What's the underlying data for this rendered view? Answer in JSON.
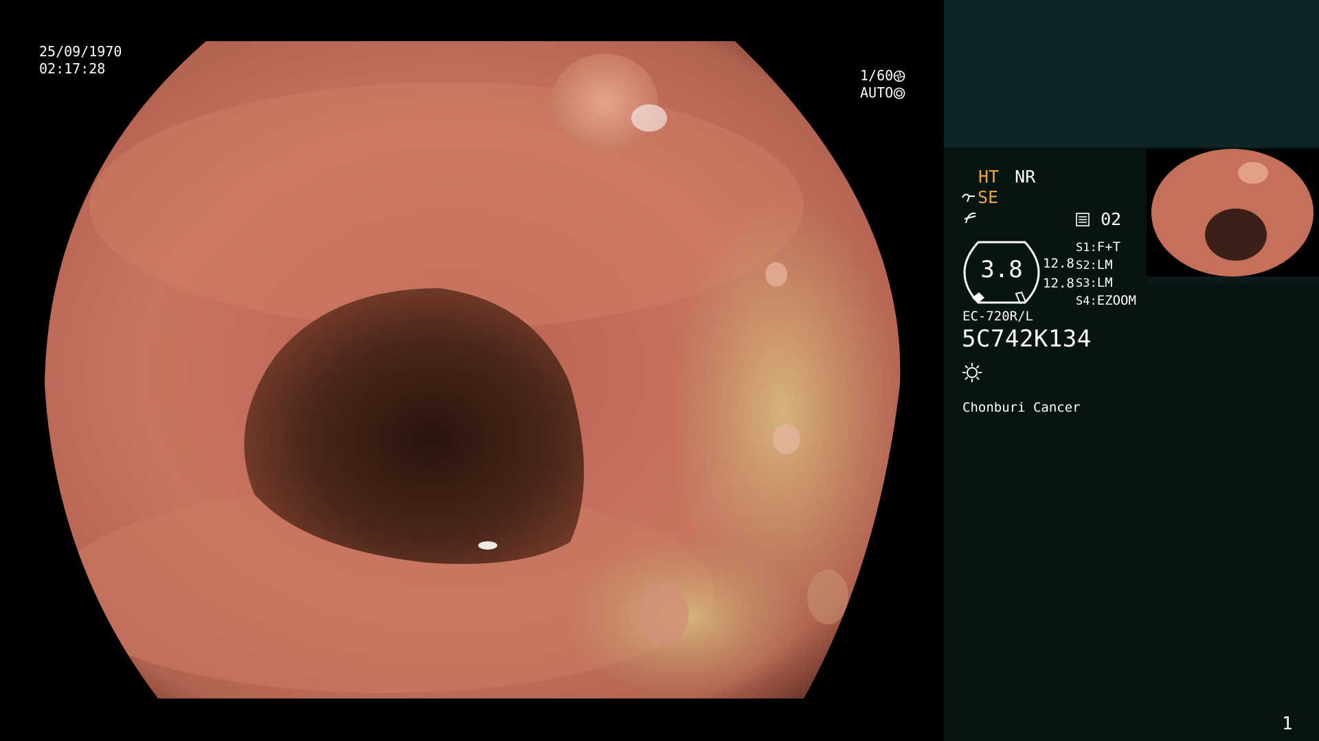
{
  "osd": {
    "date": "25/09/1970",
    "time": "02:17:28",
    "shutter": "1/60",
    "iris": "AUTO"
  },
  "panel": {
    "ht_label": "HT",
    "nr_label": "NR",
    "se_label": "SE",
    "mode_num": "02",
    "zoom_value": "3.8",
    "val_a": "12.8",
    "val_b": "12.8",
    "switches": [
      {
        "key": "S1:",
        "value": "F+T"
      },
      {
        "key": "S2:",
        "value": "LM"
      },
      {
        "key": "S3:",
        "value": "LM"
      },
      {
        "key": "S4:",
        "value": "EZOOM"
      }
    ],
    "scope_model": "EC-720R/L",
    "scope_serial": "5C742K134",
    "hospital": "Chonburi Cancer",
    "page_number": "1"
  },
  "colors": {
    "accent_orange": "#f2a53c",
    "panel_bg": "#061412",
    "panel_top_bg": "#0d2524",
    "mucosa": "#c46a54",
    "lumen": "#3a2016"
  },
  "icons": {
    "shutter": "shutter-icon",
    "iris": "iris-icon",
    "scope": "scope-icon",
    "curve": "curve-icon",
    "memory": "memory-icon",
    "light": "light-icon"
  }
}
